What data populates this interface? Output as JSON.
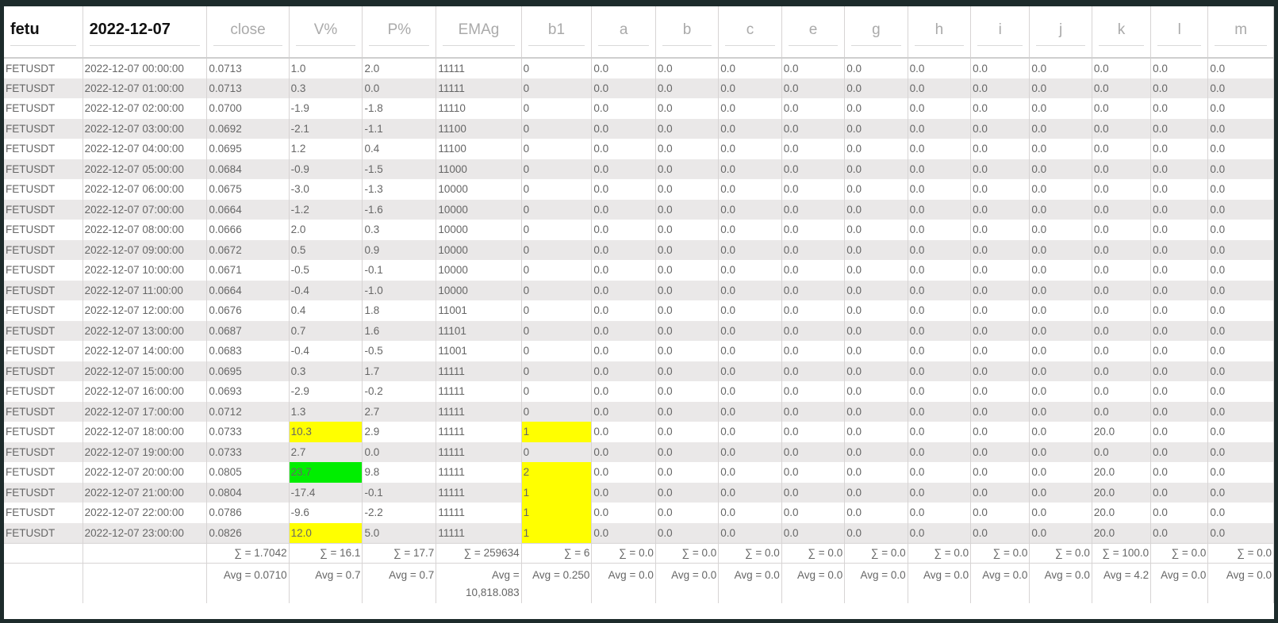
{
  "header": {
    "symbol": "fetu",
    "date": "2022-12-07",
    "columns": [
      "close",
      "V%",
      "P%",
      "EMAg",
      "b1",
      "a",
      "b",
      "c",
      "e",
      "g",
      "h",
      "i",
      "j",
      "k",
      "l",
      "m"
    ]
  },
  "colors": {
    "yellow_highlight": "#ffff00",
    "green_highlight": "#00ee00",
    "frame": "#1d2b2b",
    "row_alt": "#eae8e8"
  },
  "rows": [
    {
      "sym": "FETUSDT",
      "time": "2022-12-07 00:00:00",
      "close": "0.0713",
      "v": "1.0",
      "p": "2.0",
      "emag": "11111",
      "b1": "0",
      "a": "0.0",
      "b": "0.0",
      "c": "0.0",
      "e": "0.0",
      "g": "0.0",
      "h": "0.0",
      "i": "0.0",
      "j": "0.0",
      "k": "0.0",
      "l": "0.0",
      "m": "0.0"
    },
    {
      "sym": "FETUSDT",
      "time": "2022-12-07 01:00:00",
      "close": "0.0713",
      "v": "0.3",
      "p": "0.0",
      "emag": "11111",
      "b1": "0",
      "a": "0.0",
      "b": "0.0",
      "c": "0.0",
      "e": "0.0",
      "g": "0.0",
      "h": "0.0",
      "i": "0.0",
      "j": "0.0",
      "k": "0.0",
      "l": "0.0",
      "m": "0.0"
    },
    {
      "sym": "FETUSDT",
      "time": "2022-12-07 02:00:00",
      "close": "0.0700",
      "v": "-1.9",
      "p": "-1.8",
      "emag": "11110",
      "b1": "0",
      "a": "0.0",
      "b": "0.0",
      "c": "0.0",
      "e": "0.0",
      "g": "0.0",
      "h": "0.0",
      "i": "0.0",
      "j": "0.0",
      "k": "0.0",
      "l": "0.0",
      "m": "0.0"
    },
    {
      "sym": "FETUSDT",
      "time": "2022-12-07 03:00:00",
      "close": "0.0692",
      "v": "-2.1",
      "p": "-1.1",
      "emag": "11100",
      "b1": "0",
      "a": "0.0",
      "b": "0.0",
      "c": "0.0",
      "e": "0.0",
      "g": "0.0",
      "h": "0.0",
      "i": "0.0",
      "j": "0.0",
      "k": "0.0",
      "l": "0.0",
      "m": "0.0"
    },
    {
      "sym": "FETUSDT",
      "time": "2022-12-07 04:00:00",
      "close": "0.0695",
      "v": "1.2",
      "p": "0.4",
      "emag": "11100",
      "b1": "0",
      "a": "0.0",
      "b": "0.0",
      "c": "0.0",
      "e": "0.0",
      "g": "0.0",
      "h": "0.0",
      "i": "0.0",
      "j": "0.0",
      "k": "0.0",
      "l": "0.0",
      "m": "0.0"
    },
    {
      "sym": "FETUSDT",
      "time": "2022-12-07 05:00:00",
      "close": "0.0684",
      "v": "-0.9",
      "p": "-1.5",
      "emag": "11000",
      "b1": "0",
      "a": "0.0",
      "b": "0.0",
      "c": "0.0",
      "e": "0.0",
      "g": "0.0",
      "h": "0.0",
      "i": "0.0",
      "j": "0.0",
      "k": "0.0",
      "l": "0.0",
      "m": "0.0"
    },
    {
      "sym": "FETUSDT",
      "time": "2022-12-07 06:00:00",
      "close": "0.0675",
      "v": "-3.0",
      "p": "-1.3",
      "emag": "10000",
      "b1": "0",
      "a": "0.0",
      "b": "0.0",
      "c": "0.0",
      "e": "0.0",
      "g": "0.0",
      "h": "0.0",
      "i": "0.0",
      "j": "0.0",
      "k": "0.0",
      "l": "0.0",
      "m": "0.0"
    },
    {
      "sym": "FETUSDT",
      "time": "2022-12-07 07:00:00",
      "close": "0.0664",
      "v": "-1.2",
      "p": "-1.6",
      "emag": "10000",
      "b1": "0",
      "a": "0.0",
      "b": "0.0",
      "c": "0.0",
      "e": "0.0",
      "g": "0.0",
      "h": "0.0",
      "i": "0.0",
      "j": "0.0",
      "k": "0.0",
      "l": "0.0",
      "m": "0.0"
    },
    {
      "sym": "FETUSDT",
      "time": "2022-12-07 08:00:00",
      "close": "0.0666",
      "v": "2.0",
      "p": "0.3",
      "emag": "10000",
      "b1": "0",
      "a": "0.0",
      "b": "0.0",
      "c": "0.0",
      "e": "0.0",
      "g": "0.0",
      "h": "0.0",
      "i": "0.0",
      "j": "0.0",
      "k": "0.0",
      "l": "0.0",
      "m": "0.0"
    },
    {
      "sym": "FETUSDT",
      "time": "2022-12-07 09:00:00",
      "close": "0.0672",
      "v": "0.5",
      "p": "0.9",
      "emag": "10000",
      "b1": "0",
      "a": "0.0",
      "b": "0.0",
      "c": "0.0",
      "e": "0.0",
      "g": "0.0",
      "h": "0.0",
      "i": "0.0",
      "j": "0.0",
      "k": "0.0",
      "l": "0.0",
      "m": "0.0"
    },
    {
      "sym": "FETUSDT",
      "time": "2022-12-07 10:00:00",
      "close": "0.0671",
      "v": "-0.5",
      "p": "-0.1",
      "emag": "10000",
      "b1": "0",
      "a": "0.0",
      "b": "0.0",
      "c": "0.0",
      "e": "0.0",
      "g": "0.0",
      "h": "0.0",
      "i": "0.0",
      "j": "0.0",
      "k": "0.0",
      "l": "0.0",
      "m": "0.0"
    },
    {
      "sym": "FETUSDT",
      "time": "2022-12-07 11:00:00",
      "close": "0.0664",
      "v": "-0.4",
      "p": "-1.0",
      "emag": "10000",
      "b1": "0",
      "a": "0.0",
      "b": "0.0",
      "c": "0.0",
      "e": "0.0",
      "g": "0.0",
      "h": "0.0",
      "i": "0.0",
      "j": "0.0",
      "k": "0.0",
      "l": "0.0",
      "m": "0.0"
    },
    {
      "sym": "FETUSDT",
      "time": "2022-12-07 12:00:00",
      "close": "0.0676",
      "v": "0.4",
      "p": "1.8",
      "emag": "11001",
      "b1": "0",
      "a": "0.0",
      "b": "0.0",
      "c": "0.0",
      "e": "0.0",
      "g": "0.0",
      "h": "0.0",
      "i": "0.0",
      "j": "0.0",
      "k": "0.0",
      "l": "0.0",
      "m": "0.0"
    },
    {
      "sym": "FETUSDT",
      "time": "2022-12-07 13:00:00",
      "close": "0.0687",
      "v": "0.7",
      "p": "1.6",
      "emag": "11101",
      "b1": "0",
      "a": "0.0",
      "b": "0.0",
      "c": "0.0",
      "e": "0.0",
      "g": "0.0",
      "h": "0.0",
      "i": "0.0",
      "j": "0.0",
      "k": "0.0",
      "l": "0.0",
      "m": "0.0"
    },
    {
      "sym": "FETUSDT",
      "time": "2022-12-07 14:00:00",
      "close": "0.0683",
      "v": "-0.4",
      "p": "-0.5",
      "emag": "11001",
      "b1": "0",
      "a": "0.0",
      "b": "0.0",
      "c": "0.0",
      "e": "0.0",
      "g": "0.0",
      "h": "0.0",
      "i": "0.0",
      "j": "0.0",
      "k": "0.0",
      "l": "0.0",
      "m": "0.0"
    },
    {
      "sym": "FETUSDT",
      "time": "2022-12-07 15:00:00",
      "close": "0.0695",
      "v": "0.3",
      "p": "1.7",
      "emag": "11111",
      "b1": "0",
      "a": "0.0",
      "b": "0.0",
      "c": "0.0",
      "e": "0.0",
      "g": "0.0",
      "h": "0.0",
      "i": "0.0",
      "j": "0.0",
      "k": "0.0",
      "l": "0.0",
      "m": "0.0"
    },
    {
      "sym": "FETUSDT",
      "time": "2022-12-07 16:00:00",
      "close": "0.0693",
      "v": "-2.9",
      "p": "-0.2",
      "emag": "11111",
      "b1": "0",
      "a": "0.0",
      "b": "0.0",
      "c": "0.0",
      "e": "0.0",
      "g": "0.0",
      "h": "0.0",
      "i": "0.0",
      "j": "0.0",
      "k": "0.0",
      "l": "0.0",
      "m": "0.0"
    },
    {
      "sym": "FETUSDT",
      "time": "2022-12-07 17:00:00",
      "close": "0.0712",
      "v": "1.3",
      "p": "2.7",
      "emag": "11111",
      "b1": "0",
      "a": "0.0",
      "b": "0.0",
      "c": "0.0",
      "e": "0.0",
      "g": "0.0",
      "h": "0.0",
      "i": "0.0",
      "j": "0.0",
      "k": "0.0",
      "l": "0.0",
      "m": "0.0"
    },
    {
      "sym": "FETUSDT",
      "time": "2022-12-07 18:00:00",
      "close": "0.0733",
      "v": "10.3",
      "p": "2.9",
      "emag": "11111",
      "b1": "1",
      "a": "0.0",
      "b": "0.0",
      "c": "0.0",
      "e": "0.0",
      "g": "0.0",
      "h": "0.0",
      "i": "0.0",
      "j": "0.0",
      "k": "20.0",
      "l": "0.0",
      "m": "0.0",
      "hv": "yellow",
      "hb1": "yellow"
    },
    {
      "sym": "FETUSDT",
      "time": "2022-12-07 19:00:00",
      "close": "0.0733",
      "v": "2.7",
      "p": "0.0",
      "emag": "11111",
      "b1": "0",
      "a": "0.0",
      "b": "0.0",
      "c": "0.0",
      "e": "0.0",
      "g": "0.0",
      "h": "0.0",
      "i": "0.0",
      "j": "0.0",
      "k": "0.0",
      "l": "0.0",
      "m": "0.0"
    },
    {
      "sym": "FETUSDT",
      "time": "2022-12-07 20:00:00",
      "close": "0.0805",
      "v": "23.7",
      "p": "9.8",
      "emag": "11111",
      "b1": "2",
      "a": "0.0",
      "b": "0.0",
      "c": "0.0",
      "e": "0.0",
      "g": "0.0",
      "h": "0.0",
      "i": "0.0",
      "j": "0.0",
      "k": "20.0",
      "l": "0.0",
      "m": "0.0",
      "hv": "green",
      "hb1": "yellow"
    },
    {
      "sym": "FETUSDT",
      "time": "2022-12-07 21:00:00",
      "close": "0.0804",
      "v": "-17.4",
      "p": "-0.1",
      "emag": "11111",
      "b1": "1",
      "a": "0.0",
      "b": "0.0",
      "c": "0.0",
      "e": "0.0",
      "g": "0.0",
      "h": "0.0",
      "i": "0.0",
      "j": "0.0",
      "k": "20.0",
      "l": "0.0",
      "m": "0.0",
      "hb1": "yellow"
    },
    {
      "sym": "FETUSDT",
      "time": "2022-12-07 22:00:00",
      "close": "0.0786",
      "v": "-9.6",
      "p": "-2.2",
      "emag": "11111",
      "b1": "1",
      "a": "0.0",
      "b": "0.0",
      "c": "0.0",
      "e": "0.0",
      "g": "0.0",
      "h": "0.0",
      "i": "0.0",
      "j": "0.0",
      "k": "20.0",
      "l": "0.0",
      "m": "0.0",
      "hb1": "yellow"
    },
    {
      "sym": "FETUSDT",
      "time": "2022-12-07 23:00:00",
      "close": "0.0826",
      "v": "12.0",
      "p": "5.0",
      "emag": "11111",
      "b1": "1",
      "a": "0.0",
      "b": "0.0",
      "c": "0.0",
      "e": "0.0",
      "g": "0.0",
      "h": "0.0",
      "i": "0.0",
      "j": "0.0",
      "k": "20.0",
      "l": "0.0",
      "m": "0.0",
      "hv": "yellow",
      "hb1": "yellow"
    }
  ],
  "sums": [
    "∑ = 1.7042",
    "∑ = 16.1",
    "∑ = 17.7",
    "∑ = 259634",
    "∑ = 6",
    "∑ = 0.0",
    "∑ = 0.0",
    "∑ = 0.0",
    "∑ = 0.0",
    "∑ = 0.0",
    "∑ = 0.0",
    "∑ = 0.0",
    "∑ = 0.0",
    "∑ = 100.0",
    "∑ = 0.0",
    "∑ = 0.0"
  ],
  "avgs": [
    "Avg = 0.0710",
    "Avg = 0.7",
    "Avg = 0.7",
    "Avg = 10,818.083",
    "Avg = 0.250",
    "Avg = 0.0",
    "Avg = 0.0",
    "Avg = 0.0",
    "Avg = 0.0",
    "Avg = 0.0",
    "Avg = 0.0",
    "Avg = 0.0",
    "Avg = 0.0",
    "Avg = 4.2",
    "Avg = 0.0",
    "Avg = 0.0"
  ]
}
